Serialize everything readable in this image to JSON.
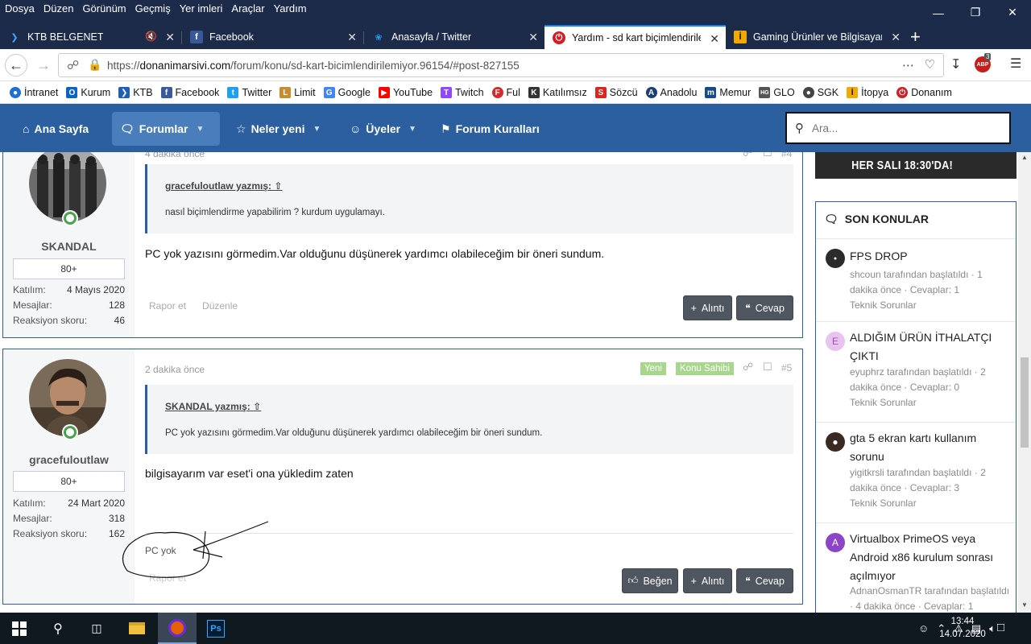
{
  "menubar": {
    "items": [
      "Dosya",
      "Düzen",
      "Görünüm",
      "Geçmiş",
      "Yer imleri",
      "Araçlar",
      "Yardım"
    ]
  },
  "tabs": [
    {
      "label": "KTB BELGENET",
      "icon": "ktb-icon"
    },
    {
      "label": "Facebook",
      "icon": "facebook-icon"
    },
    {
      "label": "Anasayfa / Twitter",
      "icon": "twitter-icon"
    },
    {
      "label": "Yardım - sd kart biçimlendirilem",
      "icon": "donanim-icon"
    },
    {
      "label": "Gaming Ürünler ve Bilgisayar Bi",
      "icon": "itopya-icon"
    }
  ],
  "urlbar": {
    "url_prefix": "https://",
    "url_domain": "donanimarsivi.com",
    "url_path": "/forum/konu/sd-kart-bicimlendirilemiyor.96154/#post-827155"
  },
  "addon_badge": "3",
  "bookmarks": [
    {
      "label": "İntranet",
      "color": "#1f6fd1"
    },
    {
      "label": "Kurum",
      "color": "#0a64c8"
    },
    {
      "label": "KTB",
      "color": "#1d5fb8"
    },
    {
      "label": "Facebook",
      "color": "#3b5998"
    },
    {
      "label": "Twitter",
      "color": "#1da1f2"
    },
    {
      "label": "Limit",
      "color": "#c98b2b"
    },
    {
      "label": "Google",
      "color": "#4285f4"
    },
    {
      "label": "YouTube",
      "color": "#ff0000"
    },
    {
      "label": "Twitch",
      "color": "#9146ff"
    },
    {
      "label": "Ful",
      "color": "#d42a2a"
    },
    {
      "label": "Katılımsız",
      "color": "#333333"
    },
    {
      "label": "Sözcü",
      "color": "#e0241b"
    },
    {
      "label": "Anadolu",
      "color": "#1b3f7a"
    },
    {
      "label": "Memur",
      "color": "#174a8c"
    },
    {
      "label": "GLO",
      "color": "#555555"
    },
    {
      "label": "SGK",
      "color": "#444444"
    },
    {
      "label": "İtopya",
      "color": "#f2a900"
    },
    {
      "label": "Donanım",
      "color": "#d01e24"
    }
  ],
  "sitenav": {
    "home": "Ana Sayfa",
    "forums": "Forumlar",
    "whats_new": "Neler yeni",
    "members": "Üyeler",
    "rules": "Forum Kuralları",
    "search_placeholder": "Ara..."
  },
  "posts": [
    {
      "time": "4 dakika önce",
      "number": "#4",
      "username": "SKANDAL",
      "rank": "80+",
      "stats": [
        {
          "label": "Katılım:",
          "value": "4 Mayıs 2020"
        },
        {
          "label": "Mesajlar:",
          "value": "128"
        },
        {
          "label": "Reaksiyon skoru:",
          "value": "46"
        }
      ],
      "quote_author": "gracefuloutlaw yazmış:",
      "quote_text": "nasıl biçimlendirme yapabilirim ? kurdum uygulamayı.",
      "body": "PC yok yazısını görmedim.Var olduğunu düşünerek yardımcı olabileceğim bir öneri sundum.",
      "report": "Rapor et",
      "edit": "Düzenle",
      "quote_btn": "Alıntı",
      "reply_btn": "Cevap"
    },
    {
      "time": "2 dakika önce",
      "number": "#5",
      "tag_new": "Yeni",
      "tag_op": "Konu Sahibi",
      "username": "gracefuloutlaw",
      "rank": "80+",
      "stats": [
        {
          "label": "Katılım:",
          "value": "24 Mart 2020"
        },
        {
          "label": "Mesajlar:",
          "value": "318"
        },
        {
          "label": "Reaksiyon skoru:",
          "value": "162"
        }
      ],
      "quote_author": "SKANDAL yazmış:",
      "quote_text": "PC yok yazısını görmedim.Var olduğunu düşünerek yardımcı olabileceğim bir öneri sundum.",
      "body": "bilgisayarım var eset'i ona yükledim zaten",
      "signature": "PC yok",
      "report": "Rapor et",
      "like_btn": "Beğen",
      "quote_btn": "Alıntı",
      "reply_btn": "Cevap"
    }
  ],
  "sidebar": {
    "banner": "HER SALI 18:30'DA!",
    "title": "SON KONULAR",
    "items": [
      {
        "title": "FPS DROP",
        "meta": "shcoun tarafından başlatıldı · 1 dakika önce · Cevaplar: 1",
        "forum": "Teknik Sorunlar",
        "avatar_letter": "",
        "avatar_color": "#2b2b2b"
      },
      {
        "title": "ALDIĞIM ÜRÜN İTHALATÇI ÇIKTI",
        "meta": "eyuphrz tarafından başlatıldı · 2 dakika önce · Cevaplar: 0",
        "forum": "Teknik Sorunlar",
        "avatar_letter": "E",
        "avatar_color": "#e8c3ef"
      },
      {
        "title": "gta 5 ekran kartı kullanım sorunu",
        "meta": "yigitkrsli tarafından başlatıldı · 2 dakika önce · Cevaplar: 3",
        "forum": "Teknik Sorunlar",
        "avatar_letter": "",
        "avatar_color": "#3a2a24"
      },
      {
        "title": "Virtualbox PrimeOS veya Android x86 kurulum sonrası açılmıyor",
        "meta": "AdnanOsmanTR tarafından başlatıldı · 4 dakika önce · Cevaplar: 1",
        "forum": "",
        "avatar_letter": "A",
        "avatar_color": "#8e44c9"
      }
    ]
  },
  "taskbar": {
    "time": "13:44",
    "date": "14.07.2020",
    "ps_label": "Ps"
  }
}
